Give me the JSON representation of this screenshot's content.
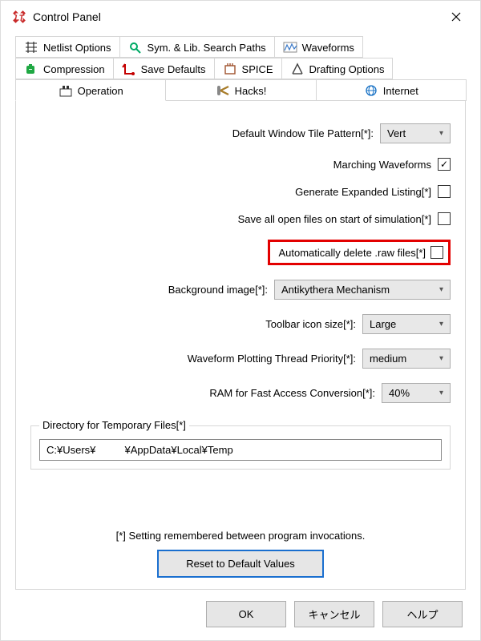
{
  "window": {
    "title": "Control Panel"
  },
  "tabs": {
    "row1": [
      {
        "name": "netlist-options",
        "label": "Netlist Options"
      },
      {
        "name": "search-paths",
        "label": "Sym. & Lib. Search Paths"
      },
      {
        "name": "waveforms",
        "label": "Waveforms"
      }
    ],
    "row2": [
      {
        "name": "compression",
        "label": "Compression"
      },
      {
        "name": "save-defaults",
        "label": "Save Defaults"
      },
      {
        "name": "spice",
        "label": "SPICE"
      },
      {
        "name": "drafting-options",
        "label": "Drafting Options"
      }
    ],
    "row3": [
      {
        "name": "operation",
        "label": "Operation",
        "active": true
      },
      {
        "name": "hacks",
        "label": "Hacks!"
      },
      {
        "name": "internet",
        "label": "Internet"
      }
    ]
  },
  "form": {
    "tile_pattern": {
      "label": "Default Window Tile Pattern[*]:",
      "value": "Vert"
    },
    "marching": {
      "label": "Marching Waveforms",
      "checked": true
    },
    "expanded_list": {
      "label": "Generate Expanded Listing[*]",
      "checked": false
    },
    "save_on_start": {
      "label": "Save all open files on start of simulation[*]",
      "checked": false
    },
    "auto_delete_raw": {
      "label": "Automatically delete .raw files[*]",
      "checked": false,
      "highlight": true
    },
    "background_img": {
      "label": "Background image[*]:",
      "value": "Antikythera Mechanism"
    },
    "toolbar_icon": {
      "label": "Toolbar icon size[*]:",
      "value": "Large"
    },
    "thread_priority": {
      "label": "Waveform Plotting Thread Priority[*]:",
      "value": "medium"
    },
    "ram_conv": {
      "label": "RAM for Fast Access Conversion[*]:",
      "value": "40%"
    }
  },
  "dir": {
    "legend": "Directory for Temporary Files[*]",
    "value": "C:¥Users¥          ¥AppData¥Local¥Temp"
  },
  "note": "[*] Setting remembered between program invocations.",
  "reset_label": "Reset to Default Values",
  "buttons": {
    "ok": "OK",
    "cancel": "キャンセル",
    "help": "ヘルプ"
  }
}
